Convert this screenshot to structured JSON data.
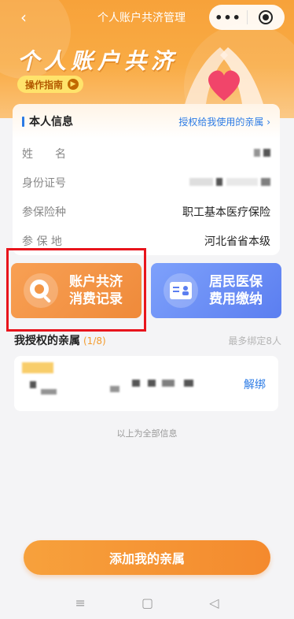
{
  "nav": {
    "back_icon": "chevron-left-icon",
    "title": "个人账户共济管理",
    "more_icon": "more-dots-icon",
    "close_icon": "target-circle-icon"
  },
  "hero": {
    "title": "个人账户共济",
    "guide_label": "操作指南",
    "guide_arrow": "chevron-right-circle-icon"
  },
  "personal_info": {
    "title": "本人信息",
    "authorized_link": "授权给我使用的亲属",
    "rows": [
      {
        "label": "姓　　名",
        "value": ""
      },
      {
        "label": "身份证号",
        "value": ""
      },
      {
        "label": "参保险种",
        "value": "职工基本医疗保险"
      },
      {
        "label": "参 保 地",
        "value": "河北省省本级"
      }
    ]
  },
  "tiles": [
    {
      "label_line1": "账户共济",
      "label_line2": "消费记录",
      "icon": "search-magnifier-icon",
      "color": "#f39646"
    },
    {
      "label_line1": "居民医保",
      "label_line2": "费用缴纳",
      "icon": "id-card-icon",
      "color": "#6b8ef5"
    }
  ],
  "family": {
    "title": "我授权的亲属",
    "count": "(1/8)",
    "limit_hint": "最多绑定8人",
    "unbind_label": "解绑"
  },
  "footer_note": "以上为全部信息",
  "add_button": "添加我的亲属",
  "system_nav": {
    "menu_icon": "≡",
    "home_icon": "▢",
    "back_icon": "◁"
  },
  "colors": {
    "accent": "#f7a23a",
    "link": "#2c7be5",
    "highlight_box": "#e8141c"
  }
}
